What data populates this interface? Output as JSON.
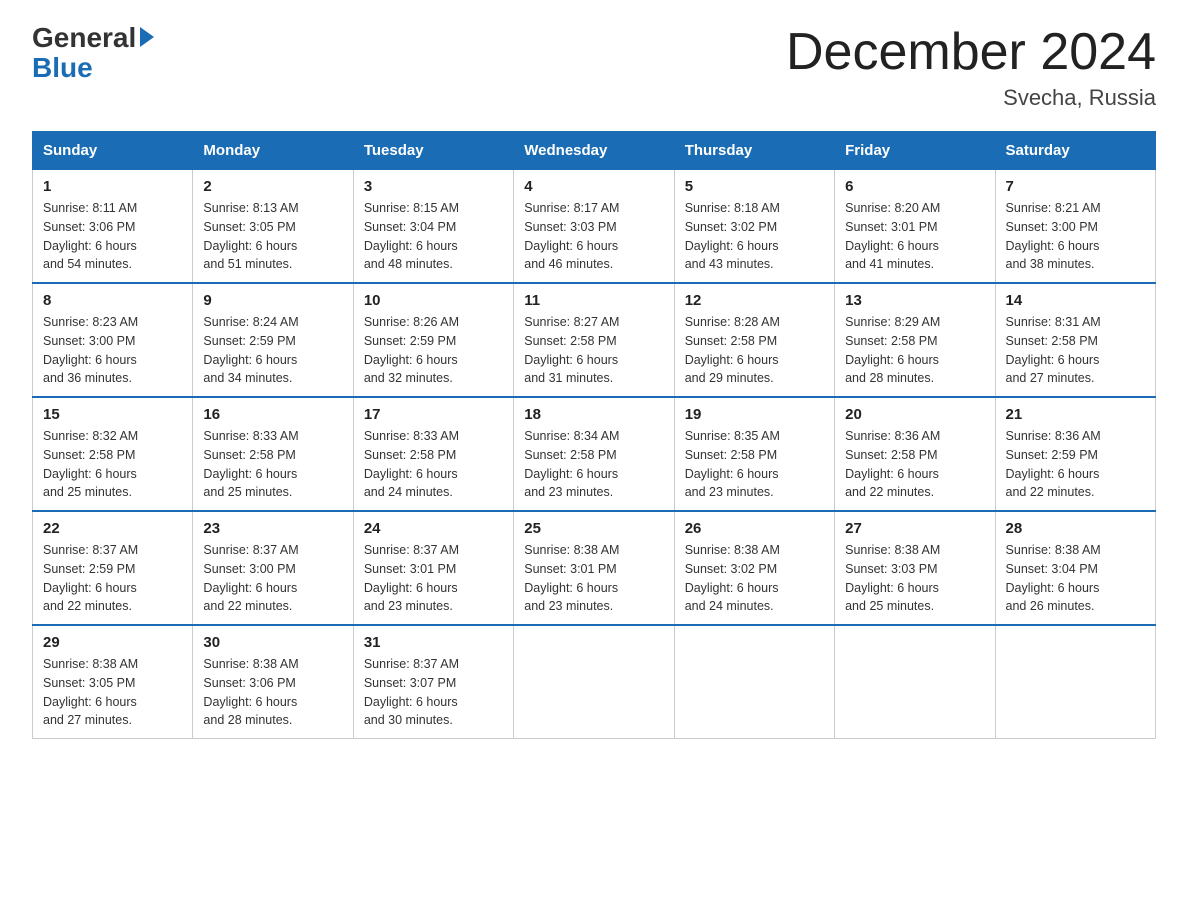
{
  "header": {
    "logo_general": "General",
    "logo_blue": "Blue",
    "title": "December 2024",
    "subtitle": "Svecha, Russia"
  },
  "days_of_week": [
    "Sunday",
    "Monday",
    "Tuesday",
    "Wednesday",
    "Thursday",
    "Friday",
    "Saturday"
  ],
  "weeks": [
    [
      {
        "day": "1",
        "info": "Sunrise: 8:11 AM\nSunset: 3:06 PM\nDaylight: 6 hours\nand 54 minutes."
      },
      {
        "day": "2",
        "info": "Sunrise: 8:13 AM\nSunset: 3:05 PM\nDaylight: 6 hours\nand 51 minutes."
      },
      {
        "day": "3",
        "info": "Sunrise: 8:15 AM\nSunset: 3:04 PM\nDaylight: 6 hours\nand 48 minutes."
      },
      {
        "day": "4",
        "info": "Sunrise: 8:17 AM\nSunset: 3:03 PM\nDaylight: 6 hours\nand 46 minutes."
      },
      {
        "day": "5",
        "info": "Sunrise: 8:18 AM\nSunset: 3:02 PM\nDaylight: 6 hours\nand 43 minutes."
      },
      {
        "day": "6",
        "info": "Sunrise: 8:20 AM\nSunset: 3:01 PM\nDaylight: 6 hours\nand 41 minutes."
      },
      {
        "day": "7",
        "info": "Sunrise: 8:21 AM\nSunset: 3:00 PM\nDaylight: 6 hours\nand 38 minutes."
      }
    ],
    [
      {
        "day": "8",
        "info": "Sunrise: 8:23 AM\nSunset: 3:00 PM\nDaylight: 6 hours\nand 36 minutes."
      },
      {
        "day": "9",
        "info": "Sunrise: 8:24 AM\nSunset: 2:59 PM\nDaylight: 6 hours\nand 34 minutes."
      },
      {
        "day": "10",
        "info": "Sunrise: 8:26 AM\nSunset: 2:59 PM\nDaylight: 6 hours\nand 32 minutes."
      },
      {
        "day": "11",
        "info": "Sunrise: 8:27 AM\nSunset: 2:58 PM\nDaylight: 6 hours\nand 31 minutes."
      },
      {
        "day": "12",
        "info": "Sunrise: 8:28 AM\nSunset: 2:58 PM\nDaylight: 6 hours\nand 29 minutes."
      },
      {
        "day": "13",
        "info": "Sunrise: 8:29 AM\nSunset: 2:58 PM\nDaylight: 6 hours\nand 28 minutes."
      },
      {
        "day": "14",
        "info": "Sunrise: 8:31 AM\nSunset: 2:58 PM\nDaylight: 6 hours\nand 27 minutes."
      }
    ],
    [
      {
        "day": "15",
        "info": "Sunrise: 8:32 AM\nSunset: 2:58 PM\nDaylight: 6 hours\nand 25 minutes."
      },
      {
        "day": "16",
        "info": "Sunrise: 8:33 AM\nSunset: 2:58 PM\nDaylight: 6 hours\nand 25 minutes."
      },
      {
        "day": "17",
        "info": "Sunrise: 8:33 AM\nSunset: 2:58 PM\nDaylight: 6 hours\nand 24 minutes."
      },
      {
        "day": "18",
        "info": "Sunrise: 8:34 AM\nSunset: 2:58 PM\nDaylight: 6 hours\nand 23 minutes."
      },
      {
        "day": "19",
        "info": "Sunrise: 8:35 AM\nSunset: 2:58 PM\nDaylight: 6 hours\nand 23 minutes."
      },
      {
        "day": "20",
        "info": "Sunrise: 8:36 AM\nSunset: 2:58 PM\nDaylight: 6 hours\nand 22 minutes."
      },
      {
        "day": "21",
        "info": "Sunrise: 8:36 AM\nSunset: 2:59 PM\nDaylight: 6 hours\nand 22 minutes."
      }
    ],
    [
      {
        "day": "22",
        "info": "Sunrise: 8:37 AM\nSunset: 2:59 PM\nDaylight: 6 hours\nand 22 minutes."
      },
      {
        "day": "23",
        "info": "Sunrise: 8:37 AM\nSunset: 3:00 PM\nDaylight: 6 hours\nand 22 minutes."
      },
      {
        "day": "24",
        "info": "Sunrise: 8:37 AM\nSunset: 3:01 PM\nDaylight: 6 hours\nand 23 minutes."
      },
      {
        "day": "25",
        "info": "Sunrise: 8:38 AM\nSunset: 3:01 PM\nDaylight: 6 hours\nand 23 minutes."
      },
      {
        "day": "26",
        "info": "Sunrise: 8:38 AM\nSunset: 3:02 PM\nDaylight: 6 hours\nand 24 minutes."
      },
      {
        "day": "27",
        "info": "Sunrise: 8:38 AM\nSunset: 3:03 PM\nDaylight: 6 hours\nand 25 minutes."
      },
      {
        "day": "28",
        "info": "Sunrise: 8:38 AM\nSunset: 3:04 PM\nDaylight: 6 hours\nand 26 minutes."
      }
    ],
    [
      {
        "day": "29",
        "info": "Sunrise: 8:38 AM\nSunset: 3:05 PM\nDaylight: 6 hours\nand 27 minutes."
      },
      {
        "day": "30",
        "info": "Sunrise: 8:38 AM\nSunset: 3:06 PM\nDaylight: 6 hours\nand 28 minutes."
      },
      {
        "day": "31",
        "info": "Sunrise: 8:37 AM\nSunset: 3:07 PM\nDaylight: 6 hours\nand 30 minutes."
      },
      {
        "day": "",
        "info": ""
      },
      {
        "day": "",
        "info": ""
      },
      {
        "day": "",
        "info": ""
      },
      {
        "day": "",
        "info": ""
      }
    ]
  ]
}
